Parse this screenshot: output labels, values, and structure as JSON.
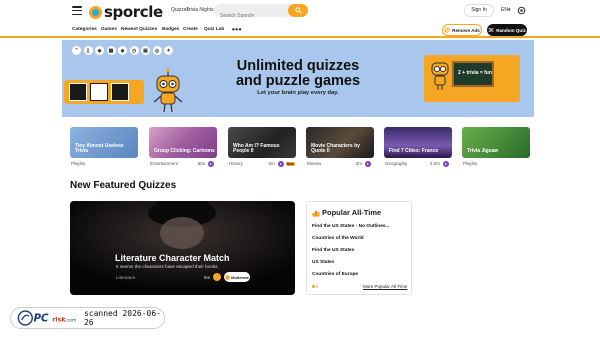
{
  "header": {
    "logo_text": "sporcle",
    "links": [
      "Quizzes",
      "Trivia Nights"
    ],
    "search_placeholder": "Search Sporcle",
    "signin": "Sign In",
    "language": "EN▾"
  },
  "categories": [
    "Categories",
    "Games",
    "Newest Quizzes",
    "Badges",
    "Create",
    "Quiz Lab"
  ],
  "more_label": "•••",
  "remove_ads": "Remove Ads",
  "random_quiz": "Random Quiz",
  "hero": {
    "title_line1": "Unlimited quizzes",
    "title_line2": "and puzzle games",
    "subtitle": "Let your brain play every day.",
    "chalkboard_text": "2 + trivia = fun"
  },
  "cards": [
    {
      "title": "Tiny Almost Useless Trivia",
      "category": "Playlist",
      "time": "",
      "new": false
    },
    {
      "title": "Group Clicking: Cartoons",
      "category": "Entertainment",
      "time": "60s",
      "new": false
    },
    {
      "title": "Who Am I? Famous People II",
      "category": "History",
      "time": "5m",
      "new": true
    },
    {
      "title": "Movie Characters by Quote II",
      "category": "Movies",
      "time": "2m",
      "new": false
    },
    {
      "title": "Find 7 Cities: France",
      "category": "Geography",
      "time": "2.5m",
      "new": false
    },
    {
      "title": "Trivia Jigsaw",
      "category": "Playlist",
      "time": "",
      "new": false
    }
  ],
  "new_badge": "New",
  "section_title": "New Featured Quizzes",
  "featured": {
    "title": "Literature Character Match",
    "subtitle": "It seems the characters have escaped their books.",
    "category": "Literature",
    "time": "5m",
    "difficulty": "Moderate"
  },
  "popular": {
    "heading": "Popular All-Time",
    "items": [
      "Find the US States - No Outlines...",
      "Countries of the World",
      "Find the US States",
      "US States",
      "Countries of Europe"
    ],
    "more_link": "More Popular All-Time"
  },
  "watermark": {
    "logo_text": "PC risk.com",
    "stamp": "scanned 2026-06-26"
  },
  "colors": {
    "accent": "#f5a623",
    "hero_bg": "#a9c7ec",
    "play": "#7b3fbf"
  }
}
